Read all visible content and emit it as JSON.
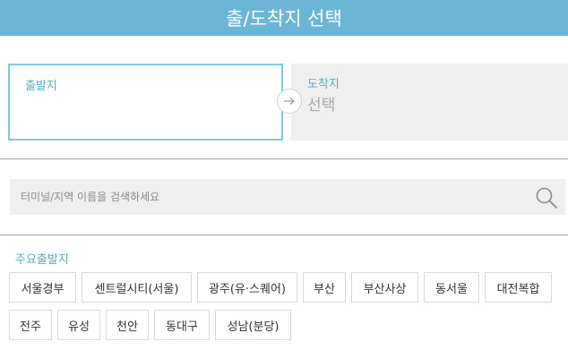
{
  "header": {
    "title": "출/도착지 선택"
  },
  "route": {
    "departure_label": "출발지",
    "arrival_label": "도착지",
    "arrival_value": "선택"
  },
  "search": {
    "placeholder": "터미널/지역 이름을 검색하세요"
  },
  "main_departures": {
    "title": "주요출발지",
    "rows": [
      [
        {
          "label": "서울경부"
        },
        {
          "label": "센트럴시티(서울)"
        },
        {
          "label": "광주(유·스퀘어)"
        },
        {
          "label": "부산"
        },
        {
          "label": "부산사상"
        },
        {
          "label": "동서울"
        },
        {
          "label": "대전복합"
        }
      ],
      [
        {
          "label": "전주"
        },
        {
          "label": "유성"
        },
        {
          "label": "천안"
        },
        {
          "label": "동대구"
        },
        {
          "label": "성남(분당)"
        }
      ]
    ]
  },
  "colors": {
    "header_bg": "#6bb6d6",
    "accent": "#5aa9c9",
    "panel_bg": "#efefef"
  },
  "icons": {
    "arrow": "arrow-right-icon",
    "search": "search-icon"
  }
}
